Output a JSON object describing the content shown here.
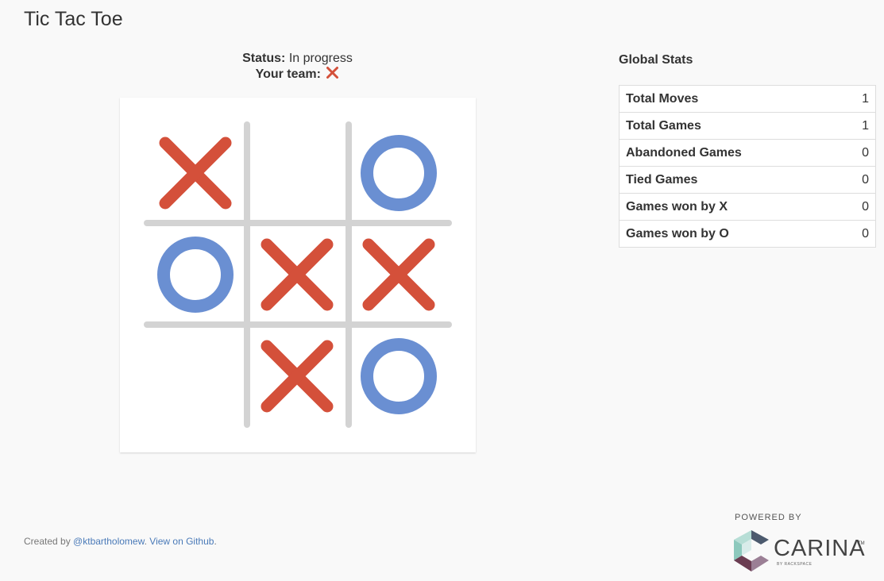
{
  "app": {
    "title": "Tic Tac Toe"
  },
  "status": {
    "status_label": "Status:",
    "status_value": "In progress",
    "team_label": "Your team:",
    "team_mark": "X"
  },
  "board": {
    "cells": [
      "X",
      "",
      "O",
      "O",
      "X",
      "X",
      "",
      "X",
      "O"
    ],
    "colors": {
      "x": "#d4503a",
      "o": "#6a8fd2",
      "grid": "#d3d3d3"
    }
  },
  "stats": {
    "title": "Global Stats",
    "rows": [
      {
        "label": "Total Moves",
        "value": "1"
      },
      {
        "label": "Total Games",
        "value": "1"
      },
      {
        "label": "Abandoned Games",
        "value": "0"
      },
      {
        "label": "Tied Games",
        "value": "0"
      },
      {
        "label": "Games won by X",
        "value": "0"
      },
      {
        "label": "Games won by O",
        "value": "0"
      }
    ]
  },
  "footer": {
    "created_by": "Created by ",
    "author_link": "@ktbartholomew",
    "separator": ". ",
    "github_link": "View on Github",
    "end": "."
  },
  "branding": {
    "powered_by": "POWERED BY",
    "name": "CARINA",
    "tm": "TM",
    "sub": "BY RACKSPACE"
  }
}
